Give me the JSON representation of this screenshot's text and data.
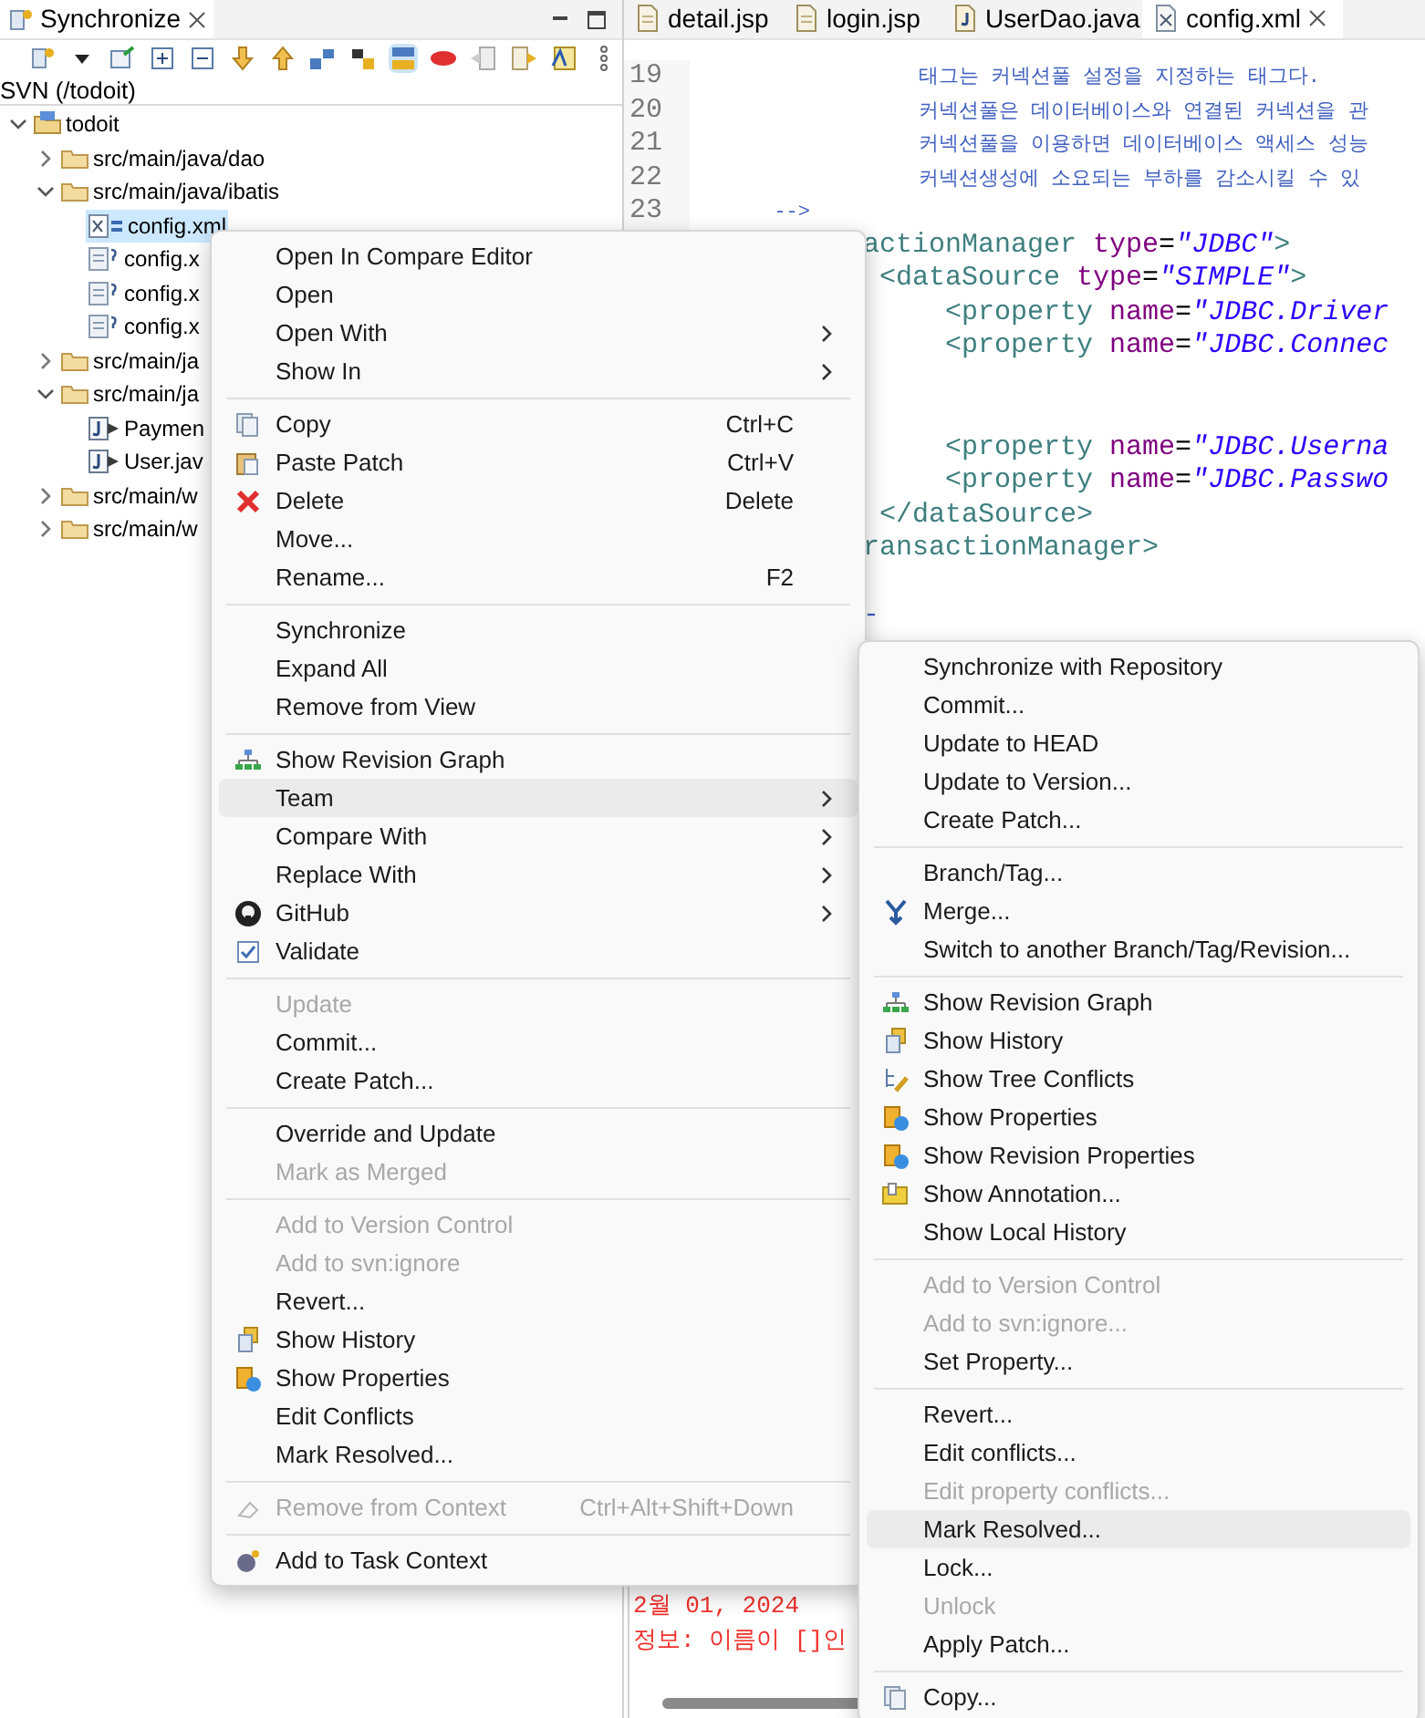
{
  "view": {
    "tab": {
      "label": "Synchronize",
      "selected": true
    },
    "header": "SVN (/todoit)"
  },
  "tree": [
    {
      "label": "todoit",
      "kind": "project",
      "expanded": true,
      "selected": false,
      "children": [
        {
          "label": "src/main/java/dao",
          "kind": "package",
          "expanded": false,
          "selected": false
        },
        {
          "label": "src/main/java/ibatis",
          "kind": "package",
          "expanded": true,
          "selected": false,
          "children": [
            {
              "label": "config.xml",
              "kind": "xml",
              "selected": true
            },
            {
              "label": "config.x",
              "kind": "unversioned",
              "selected": false
            },
            {
              "label": "config.x",
              "kind": "unversioned",
              "selected": false
            },
            {
              "label": "config.x",
              "kind": "unversioned",
              "selected": false
            }
          ]
        },
        {
          "label": "src/main/ja",
          "kind": "package",
          "expanded": false,
          "selected": false
        },
        {
          "label": "src/main/ja",
          "kind": "package",
          "expanded": true,
          "selected": false,
          "children": [
            {
              "label": "Paymen",
              "kind": "java",
              "selected": false
            },
            {
              "label": "User.jav",
              "kind": "java",
              "selected": false
            }
          ]
        },
        {
          "label": "src/main/w",
          "kind": "package",
          "expanded": false,
          "selected": false
        },
        {
          "label": "src/main/w",
          "kind": "package",
          "expanded": false,
          "selected": false
        }
      ]
    }
  ],
  "editor": {
    "tabs": [
      {
        "label": "detail.jsp",
        "kind": "file",
        "selected": false
      },
      {
        "label": "login.jsp",
        "kind": "file",
        "selected": false
      },
      {
        "label": "UserDao.java",
        "kind": "java",
        "selected": false
      },
      {
        "label": "config.xml",
        "kind": "xml",
        "selected": true
      }
    ],
    "lines": [
      {
        "kind": "full",
        "number": "19",
        "tokens": [
          {
            "kind": "comment",
            "text": "                   태그는 커넥션풀 설정을 지정하는 태그다."
          }
        ]
      },
      {
        "kind": "full",
        "number": "20",
        "tokens": [
          {
            "kind": "comment",
            "text": "                   커넥션풀은 데이터베이스와 연결된 커넥션을 관"
          }
        ]
      },
      {
        "kind": "full",
        "number": "21",
        "tokens": [
          {
            "kind": "comment",
            "text": "                   커넥션풀을 이용하면 데이터베이스 액세스 성능"
          }
        ]
      },
      {
        "kind": "full",
        "number": "22",
        "tokens": [
          {
            "kind": "comment",
            "text": "                   커넥션생성에 소요되는 부하를 감소시킬 수 있"
          }
        ]
      },
      {
        "kind": "full",
        "number": "23",
        "tokens": [
          {
            "kind": "comment",
            "text": "       -->"
          }
        ]
      },
      {
        "kind": "continued",
        "tokens": [
          {
            "kind": "tag",
            "text": "actionManager"
          },
          {
            "kind": "attr",
            "text": " type"
          },
          {
            "kind": "plain",
            "text": "="
          },
          {
            "kind": "value",
            "text": "\"JDBC\""
          },
          {
            "kind": "tag",
            "text": ">"
          }
        ]
      },
      {
        "kind": "continued",
        "tokens": [
          {
            "kind": "tag",
            "text": " <dataSource"
          },
          {
            "kind": "attr",
            "text": " type"
          },
          {
            "kind": "plain",
            "text": "="
          },
          {
            "kind": "value",
            "text": "\"SIMPLE\""
          },
          {
            "kind": "tag",
            "text": ">"
          }
        ]
      },
      {
        "kind": "continued",
        "tokens": [
          {
            "kind": "tag",
            "text": "     <property"
          },
          {
            "kind": "attr",
            "text": " name"
          },
          {
            "kind": "plain",
            "text": "="
          },
          {
            "kind": "value",
            "text": "\"JDBC.Driver"
          }
        ]
      },
      {
        "kind": "continued",
        "tokens": [
          {
            "kind": "tag",
            "text": "     <property"
          },
          {
            "kind": "attr",
            "text": " name"
          },
          {
            "kind": "plain",
            "text": "="
          },
          {
            "kind": "value",
            "text": "\"JDBC.Connec"
          }
        ]
      },
      {
        "kind": "blank"
      },
      {
        "kind": "blank"
      },
      {
        "kind": "continued",
        "tokens": [
          {
            "kind": "tag",
            "text": "     <property"
          },
          {
            "kind": "attr",
            "text": " name"
          },
          {
            "kind": "plain",
            "text": "="
          },
          {
            "kind": "value",
            "text": "\"JDBC.Userna"
          }
        ]
      },
      {
        "kind": "continued",
        "tokens": [
          {
            "kind": "tag",
            "text": "     <property"
          },
          {
            "kind": "attr",
            "text": " name"
          },
          {
            "kind": "plain",
            "text": "="
          },
          {
            "kind": "value",
            "text": "\"JDBC.Passwo"
          }
        ]
      },
      {
        "kind": "continued",
        "tokens": [
          {
            "kind": "tag",
            "text": " </dataSource>"
          }
        ]
      },
      {
        "kind": "continued",
        "tokens": [
          {
            "kind": "tag",
            "text": "ransactionManager>"
          }
        ]
      },
      {
        "kind": "blank"
      },
      {
        "kind": "continued",
        "tokens": [
          {
            "kind": "comment",
            "text": "-"
          }
        ]
      }
    ],
    "console": [
      "2월 01, 2024",
      "정보: 이름이 []인"
    ]
  },
  "menu": {
    "sections": [
      {
        "items": [
          {
            "label": "Open In Compare Editor",
            "submenu": false,
            "disabled": false,
            "selected": false
          },
          {
            "label": "Open",
            "submenu": false,
            "disabled": false,
            "selected": false
          },
          {
            "label": "Open With",
            "submenu": true,
            "disabled": false,
            "selected": false
          },
          {
            "label": "Show In",
            "submenu": true,
            "disabled": false,
            "selected": false
          }
        ]
      },
      {
        "items": [
          {
            "label": "Copy",
            "shortcut": "Ctrl+C",
            "submenu": false,
            "disabled": false,
            "selected": false
          },
          {
            "label": "Paste Patch",
            "shortcut": "Ctrl+V",
            "submenu": false,
            "disabled": false,
            "selected": false
          },
          {
            "label": "Delete",
            "shortcut": "Delete",
            "submenu": false,
            "disabled": false,
            "selected": false
          },
          {
            "label": "Move...",
            "submenu": false,
            "disabled": false,
            "selected": false
          },
          {
            "label": "Rename...",
            "shortcut": "F2",
            "submenu": false,
            "disabled": false,
            "selected": false
          }
        ]
      },
      {
        "items": [
          {
            "label": "Synchronize",
            "submenu": false,
            "disabled": false,
            "selected": false
          },
          {
            "label": "Expand All",
            "submenu": false,
            "disabled": false,
            "selected": false
          },
          {
            "label": "Remove from View",
            "submenu": false,
            "disabled": false,
            "selected": false
          }
        ]
      },
      {
        "items": [
          {
            "label": "Show Revision Graph",
            "submenu": false,
            "disabled": false,
            "selected": false
          },
          {
            "label": "Team",
            "submenu": true,
            "disabled": false,
            "selected": true
          },
          {
            "label": "Compare With",
            "submenu": true,
            "disabled": false,
            "selected": false
          },
          {
            "label": "Replace With",
            "submenu": true,
            "disabled": false,
            "selected": false
          },
          {
            "label": "GitHub",
            "submenu": true,
            "disabled": false,
            "selected": false
          },
          {
            "label": "Validate",
            "submenu": false,
            "disabled": false,
            "selected": false
          }
        ]
      },
      {
        "items": [
          {
            "label": "Update",
            "submenu": false,
            "disabled": true,
            "selected": false
          },
          {
            "label": "Commit...",
            "submenu": false,
            "disabled": false,
            "selected": false
          },
          {
            "label": "Create Patch...",
            "submenu": false,
            "disabled": false,
            "selected": false
          }
        ]
      },
      {
        "items": [
          {
            "label": "Override and Update",
            "submenu": false,
            "disabled": false,
            "selected": false
          },
          {
            "label": "Mark as Merged",
            "submenu": false,
            "disabled": true,
            "selected": false
          }
        ]
      },
      {
        "items": [
          {
            "label": "Add to Version Control",
            "submenu": false,
            "disabled": true,
            "selected": false
          },
          {
            "label": "Add to svn:ignore",
            "submenu": false,
            "disabled": true,
            "selected": false
          },
          {
            "label": "Revert...",
            "submenu": false,
            "disabled": false,
            "selected": false
          },
          {
            "label": "Show History",
            "submenu": false,
            "disabled": false,
            "selected": false
          },
          {
            "label": "Show Properties",
            "submenu": false,
            "disabled": false,
            "selected": false
          },
          {
            "label": "Edit Conflicts",
            "submenu": false,
            "disabled": false,
            "selected": false
          },
          {
            "label": "Mark Resolved...",
            "submenu": false,
            "disabled": false,
            "selected": false
          }
        ]
      },
      {
        "items": [
          {
            "label": "Remove from Context",
            "shortcut": "Ctrl+Alt+Shift+Down",
            "submenu": false,
            "disabled": true,
            "selected": false
          }
        ]
      },
      {
        "items": [
          {
            "label": "Add to Task Context",
            "submenu": false,
            "disabled": false,
            "selected": false
          }
        ]
      }
    ]
  },
  "submenu": {
    "sections": [
      {
        "items": [
          {
            "label": "Synchronize with Repository",
            "disabled": false,
            "selected": false
          },
          {
            "label": "Commit...",
            "disabled": false,
            "selected": false
          },
          {
            "label": "Update to HEAD",
            "disabled": false,
            "selected": false
          },
          {
            "label": "Update to Version...",
            "disabled": false,
            "selected": false
          },
          {
            "label": "Create Patch...",
            "disabled": false,
            "selected": false
          }
        ]
      },
      {
        "items": [
          {
            "label": "Branch/Tag...",
            "disabled": false,
            "selected": false
          },
          {
            "label": "Merge...",
            "disabled": false,
            "selected": false
          },
          {
            "label": "Switch to another Branch/Tag/Revision...",
            "disabled": false,
            "selected": false
          }
        ]
      },
      {
        "items": [
          {
            "label": "Show Revision Graph",
            "disabled": false,
            "selected": false
          },
          {
            "label": "Show History",
            "disabled": false,
            "selected": false
          },
          {
            "label": "Show Tree Conflicts",
            "disabled": false,
            "selected": false
          },
          {
            "label": "Show Properties",
            "disabled": false,
            "selected": false
          },
          {
            "label": "Show Revision Properties",
            "disabled": false,
            "selected": false
          },
          {
            "label": "Show Annotation...",
            "disabled": false,
            "selected": false
          },
          {
            "label": "Show Local History",
            "disabled": false,
            "selected": false
          }
        ]
      },
      {
        "items": [
          {
            "label": "Add to Version Control",
            "disabled": true,
            "selected": false
          },
          {
            "label": "Add to svn:ignore...",
            "disabled": true,
            "selected": false
          },
          {
            "label": "Set Property...",
            "disabled": false,
            "selected": false
          }
        ]
      },
      {
        "items": [
          {
            "label": "Revert...",
            "disabled": false,
            "selected": false
          },
          {
            "label": "Edit conflicts...",
            "disabled": false,
            "selected": false
          },
          {
            "label": "Edit property conflicts...",
            "disabled": true,
            "selected": false
          },
          {
            "label": "Mark Resolved...",
            "disabled": false,
            "selected": true
          },
          {
            "label": "Lock...",
            "disabled": false,
            "selected": false
          },
          {
            "label": "Unlock",
            "disabled": true,
            "selected": false
          },
          {
            "label": "Apply Patch...",
            "disabled": false,
            "selected": false
          }
        ]
      },
      {
        "items": [
          {
            "label": "Copy...",
            "disabled": false,
            "selected": false
          }
        ]
      }
    ]
  }
}
